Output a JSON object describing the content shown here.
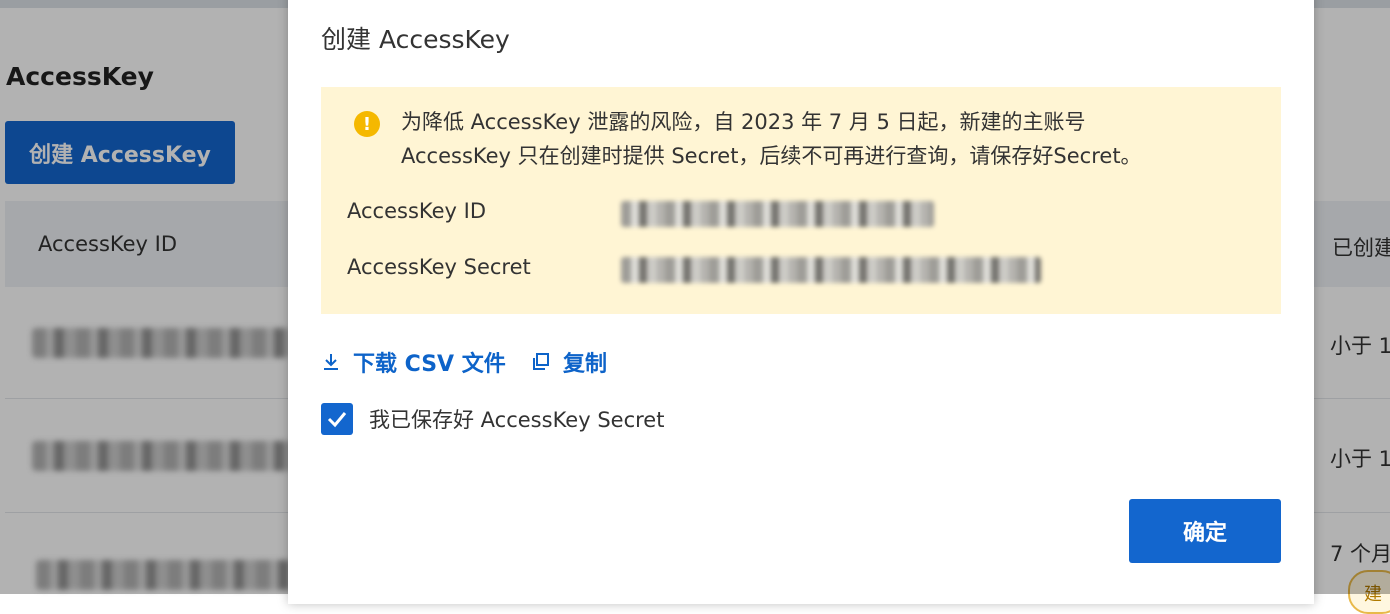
{
  "background": {
    "heading": "AccessKey",
    "create_button": "创建 AccessKey",
    "table": {
      "columns": [
        "AccessKey ID",
        "已创建"
      ],
      "rows": [
        {
          "time": "小于 1"
        },
        {
          "time": "小于 1"
        },
        {
          "time": "7 个月"
        }
      ],
      "tag": "建"
    }
  },
  "dialog": {
    "title": "创建 AccessKey",
    "warning": {
      "line1": "为降低 AccessKey 泄露的风险，自 2023 年 7 月 5 日起，新建的主账号",
      "line2": "AccessKey 只在创建时提供 Secret，后续不可再进行查询，请保存好Secret。"
    },
    "fields": {
      "id_label": "AccessKey ID",
      "secret_label": "AccessKey Secret"
    },
    "actions": {
      "download_label": "下载 CSV 文件",
      "copy_label": "复制"
    },
    "checkbox": {
      "label": "我已保存好 AccessKey Secret",
      "checked": true
    },
    "confirm_label": "确定"
  },
  "colors": {
    "primary": "#1366ce",
    "warning_bg": "#fff5d4",
    "warning_icon": "#f5b800",
    "link": "#0d63c9"
  },
  "icons": [
    "warning-icon",
    "download-icon",
    "copy-icon",
    "checkmark-icon"
  ]
}
